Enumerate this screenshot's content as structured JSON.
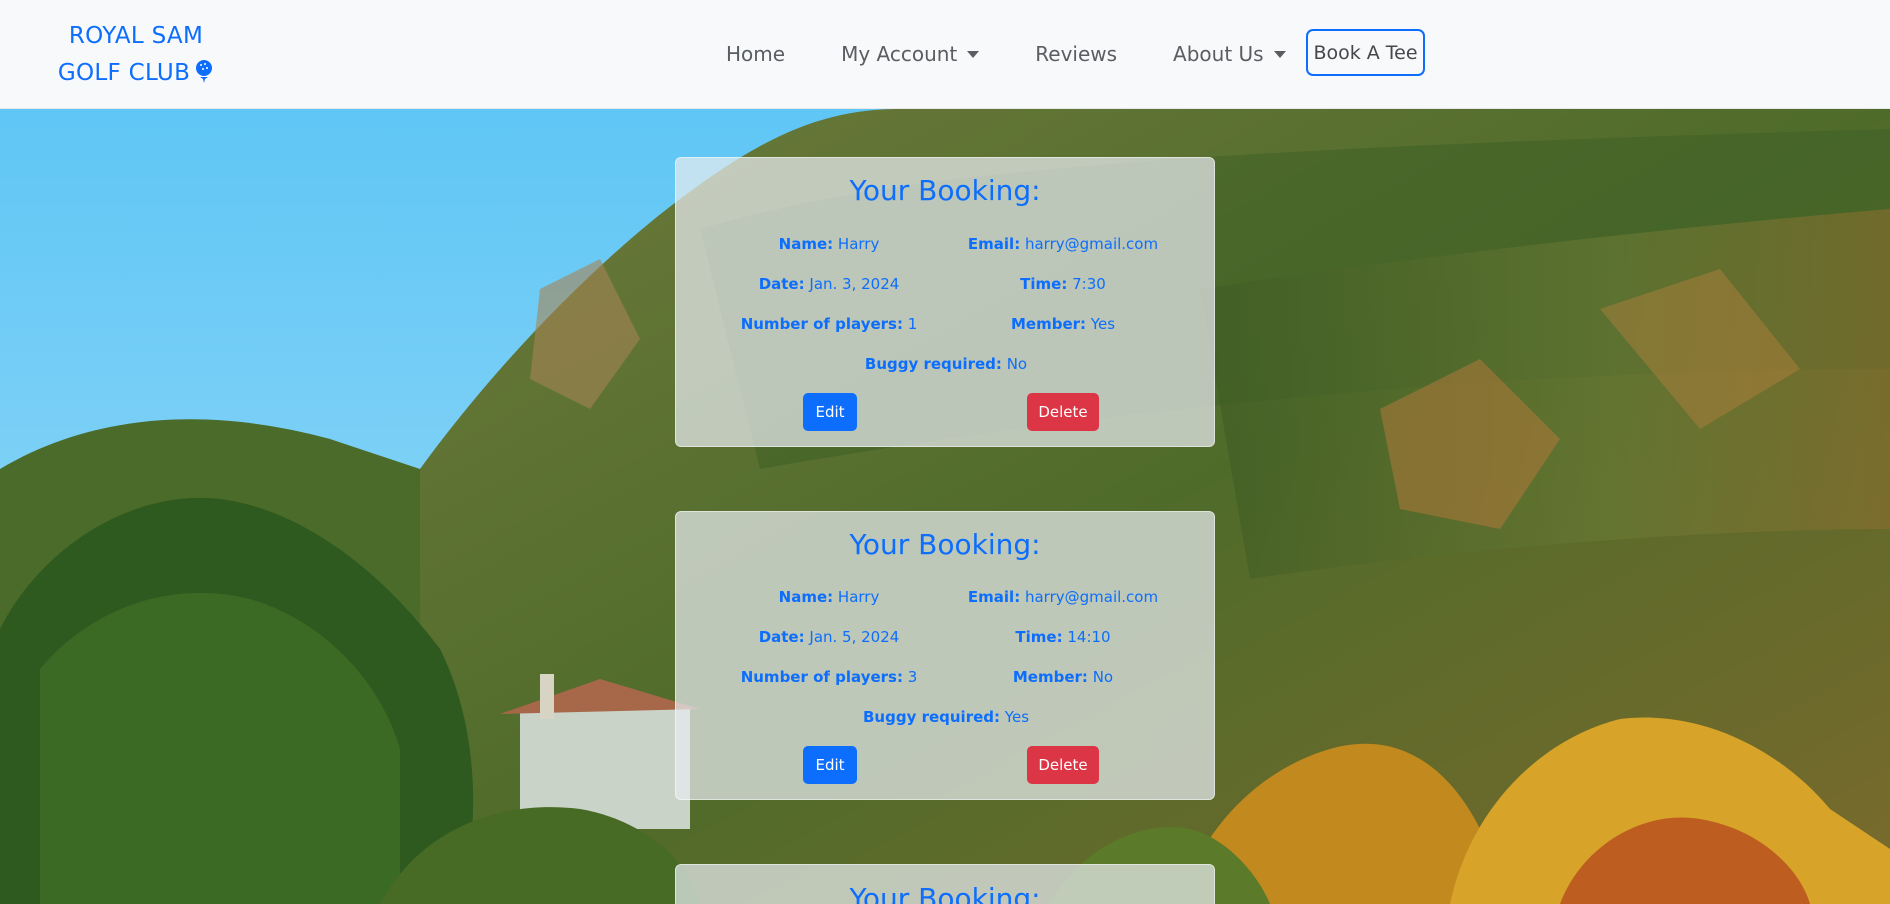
{
  "brand": {
    "line1": "ROYAL SAM",
    "line2": "GOLF CLUB",
    "icon": "golf-ball-tee-icon"
  },
  "nav": {
    "home": "Home",
    "my_account": "My Account",
    "reviews": "Reviews",
    "about_us": "About Us",
    "book_a_tee": "Book A Tee"
  },
  "bookings": [
    {
      "title": "Your Booking:",
      "name_label": "Name:",
      "name": "Harry",
      "email_label": "Email:",
      "email": "harry@gmail.com",
      "date_label": "Date:",
      "date": "Jan. 3, 2024",
      "time_label": "Time:",
      "time": "7:30",
      "players_label": "Number of players:",
      "players": "1",
      "member_label": "Member:",
      "member": "Yes",
      "buggy_label": "Buggy required:",
      "buggy": "No",
      "edit_label": "Edit",
      "delete_label": "Delete"
    },
    {
      "title": "Your Booking:",
      "name_label": "Name:",
      "name": "Harry",
      "email_label": "Email:",
      "email": "harry@gmail.com",
      "date_label": "Date:",
      "date": "Jan. 5, 2024",
      "time_label": "Time:",
      "time": "14:10",
      "players_label": "Number of players:",
      "players": "3",
      "member_label": "Member:",
      "member": "No",
      "buggy_label": "Buggy required:",
      "buggy": "Yes",
      "edit_label": "Edit",
      "delete_label": "Delete"
    },
    {
      "title": "Your Booking:"
    }
  ],
  "colors": {
    "accent": "#0d6efd",
    "danger": "#dc3545",
    "navbar_bg": "#f8f9fa"
  }
}
